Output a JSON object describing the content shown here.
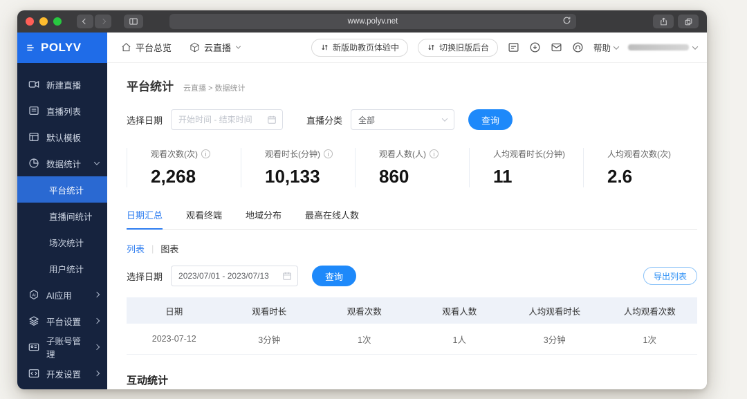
{
  "browser": {
    "url": "www.polyv.net"
  },
  "brand": {
    "logo": "POLYV"
  },
  "topnav": {
    "home": "平台总览",
    "product": "云直播",
    "pill_new": "新版助教页体验中",
    "pill_old": "切换旧版后台",
    "help": "帮助"
  },
  "sidebar": {
    "items": [
      {
        "label": "新建直播",
        "icon": "camera-icon"
      },
      {
        "label": "直播列表",
        "icon": "list-icon"
      },
      {
        "label": "默认模板",
        "icon": "template-icon"
      },
      {
        "label": "数据统计",
        "icon": "pie-chart-icon",
        "expanded": true
      }
    ],
    "subitems": [
      {
        "label": "平台统计",
        "active": true
      },
      {
        "label": "直播间统计",
        "active": false
      },
      {
        "label": "场次统计",
        "active": false
      },
      {
        "label": "用户统计",
        "active": false
      }
    ],
    "groups": [
      {
        "label": "AI应用",
        "icon": "ai-icon"
      },
      {
        "label": "平台设置",
        "icon": "layers-icon"
      },
      {
        "label": "子账号管理",
        "icon": "id-card-icon"
      },
      {
        "label": "开发设置",
        "icon": "code-icon"
      }
    ]
  },
  "page": {
    "title": "平台统计",
    "crumb1": "云直播",
    "crumb_sep": ">",
    "crumb2": "数据统计",
    "filters": {
      "date_label": "选择日期",
      "date_placeholder": "开始时间 - 结束时间",
      "category_label": "直播分类",
      "category_value": "全部",
      "query_label": "查询"
    },
    "stats": [
      {
        "label": "观看次数(次)",
        "info": true,
        "value": "2,268"
      },
      {
        "label": "观看时长(分钟)",
        "info": true,
        "value": "10,133"
      },
      {
        "label": "观看人数(人)",
        "info": true,
        "value": "860"
      },
      {
        "label": "人均观看时长(分钟)",
        "info": false,
        "value": "11"
      },
      {
        "label": "人均观看次数(次)",
        "info": false,
        "value": "2.6"
      }
    ],
    "tabs": [
      {
        "label": "日期汇总",
        "active": true
      },
      {
        "label": "观看终端",
        "active": false
      },
      {
        "label": "地域分布",
        "active": false
      },
      {
        "label": "最高在线人数",
        "active": false
      }
    ],
    "view_toggle": {
      "list": "列表",
      "sep": "|",
      "chart": "图表"
    },
    "range": {
      "date_label": "选择日期",
      "date_value": "2023/07/01 - 2023/07/13",
      "query_label": "查询",
      "export_label": "导出列表"
    },
    "table": {
      "headers": [
        "日期",
        "观看时长",
        "观看次数",
        "观看人数",
        "人均观看时长",
        "人均观看次数"
      ],
      "rows": [
        [
          "2023-07-12",
          "3分钟",
          "1次",
          "1人",
          "3分钟",
          "1次"
        ]
      ]
    },
    "section_interactive": "互动统计"
  },
  "colors": {
    "brand_blue": "#1f6ce8",
    "button_blue": "#1e89fa",
    "link_blue": "#2e7df0",
    "sidebar_bg": "#16233e",
    "sidebar_active": "#2a69d2",
    "table_header_bg": "#eef2f9"
  }
}
